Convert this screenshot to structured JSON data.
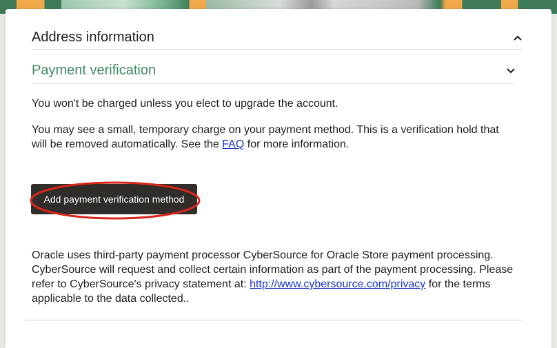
{
  "colors": {
    "accent_green": "#3f8a61",
    "button_bg": "#312d2a",
    "annotation_red": "#d8261c",
    "link": "#1a36c8"
  },
  "sections": {
    "address": {
      "title": "Address information",
      "icon": "chevron-up-icon"
    },
    "payment": {
      "title": "Payment verification",
      "icon": "chevron-down-icon"
    }
  },
  "payment": {
    "line1": "You won't be charged unless you elect to upgrade the account.",
    "line2_pre": "You may see a small, temporary charge on your payment method. This is a verification hold that will be removed automatically. See the ",
    "faq_link": "FAQ",
    "line2_post": " for more information.",
    "button_label": "Add payment verification method",
    "processor_pre": "Oracle uses third-party payment processor CyberSource for Oracle Store payment processing. CyberSource will request and collect certain information as part of the payment processing. Please refer to CyberSource's privacy statement at: ",
    "privacy_link": "http://www.cybersource.com/privacy",
    "processor_post": " for the terms applicable to the data collected.."
  }
}
